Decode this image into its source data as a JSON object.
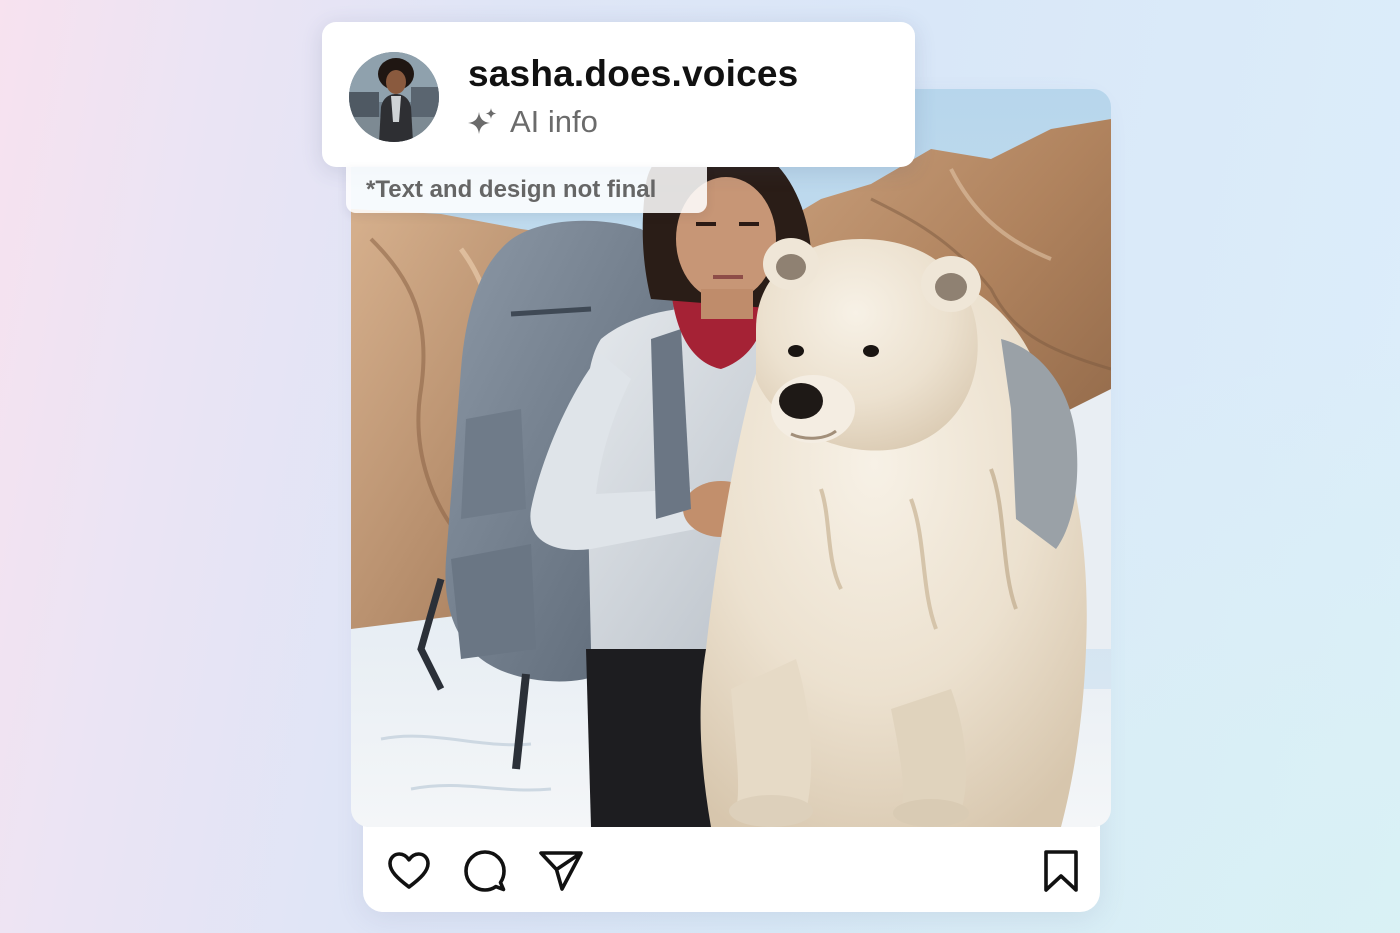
{
  "post": {
    "username": "sasha.does.voices",
    "ai_label": "AI info",
    "disclaimer": "*Text and design not final",
    "photo_alt": "Woman with a grey backpack standing next to a polar bear in a rocky snowy landscape",
    "avatar_alt": "Profile photo of sasha.does.voices"
  },
  "actions": [
    {
      "name": "like",
      "icon": "heart-icon"
    },
    {
      "name": "comment",
      "icon": "comment-bubble-icon"
    },
    {
      "name": "share",
      "icon": "send-paper-plane-icon"
    },
    {
      "name": "save",
      "icon": "bookmark-icon"
    }
  ],
  "colors": {
    "card_background": "#ffffff",
    "icon_stroke": "#111111",
    "ai_label_text": "#6b6b6b",
    "disclaimer_text": "#666666"
  }
}
